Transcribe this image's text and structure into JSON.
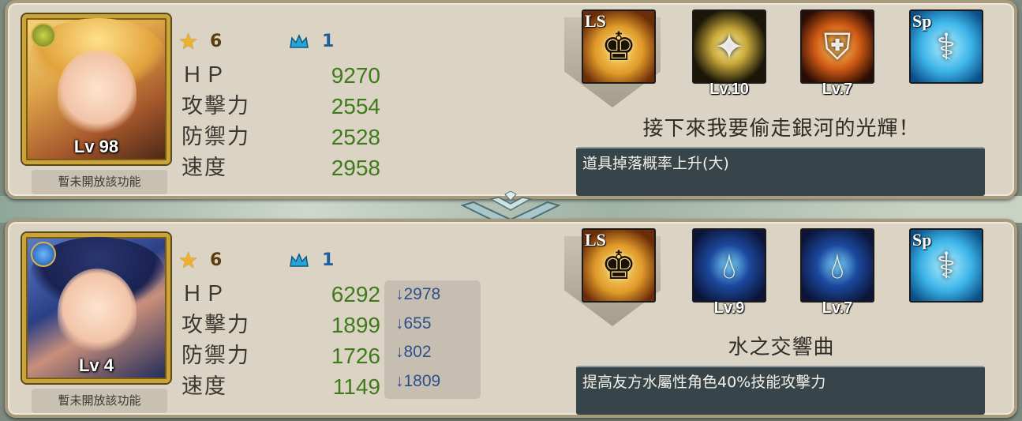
{
  "units": [
    {
      "level_label": "Lv 98",
      "not_open_label": "暫未開放該功能",
      "stars": "6",
      "crowns": "1",
      "stats": [
        {
          "label": "ＨＰ",
          "value": "9270"
        },
        {
          "label": "攻擊力",
          "value": "2554"
        },
        {
          "label": "防禦力",
          "value": "2528"
        },
        {
          "label": "速度",
          "value": "2958"
        }
      ],
      "diffs": [],
      "skills": {
        "ls_tag": "LS",
        "sp_tag": "Sp",
        "s1_level": "Lv.10",
        "s2_level": "Lv.7"
      },
      "skill_name": "接下來我要偷走銀河的光輝！",
      "skill_desc": "道具掉落概率上升(大)"
    },
    {
      "level_label": "Lv 4",
      "not_open_label": "暫未開放該功能",
      "stars": "6",
      "crowns": "1",
      "stats": [
        {
          "label": "ＨＰ",
          "value": "6292"
        },
        {
          "label": "攻擊力",
          "value": "1899"
        },
        {
          "label": "防禦力",
          "value": "1726"
        },
        {
          "label": "速度",
          "value": "1149"
        }
      ],
      "diffs": [
        "↓2978",
        "↓655",
        "↓802",
        "↓1809"
      ],
      "skills": {
        "ls_tag": "LS",
        "sp_tag": "Sp",
        "s1_level": "Lv.9",
        "s2_level": "Lv.7"
      },
      "skill_name": "水之交響曲",
      "skill_desc": "提高友方水屬性角色40%技能攻擊力"
    }
  ],
  "icons": {
    "star": "star-icon",
    "crown": "crown-icon",
    "element_top": "light-element-icon",
    "element_bottom": "water-element-icon",
    "leader_skill": "crown-leader-icon",
    "special": "caduceus-icon",
    "top_skill1": "cross-star-icon",
    "top_skill2": "shield-icon",
    "bottom_skill1": "water-drop-icon",
    "bottom_skill2": "water-drop-heart-icon"
  },
  "colors": {
    "stat_value": "#3f7a1d",
    "diff_value": "#2d4f8e",
    "star": "#f0b12a",
    "crown": "#2aa4d8"
  }
}
